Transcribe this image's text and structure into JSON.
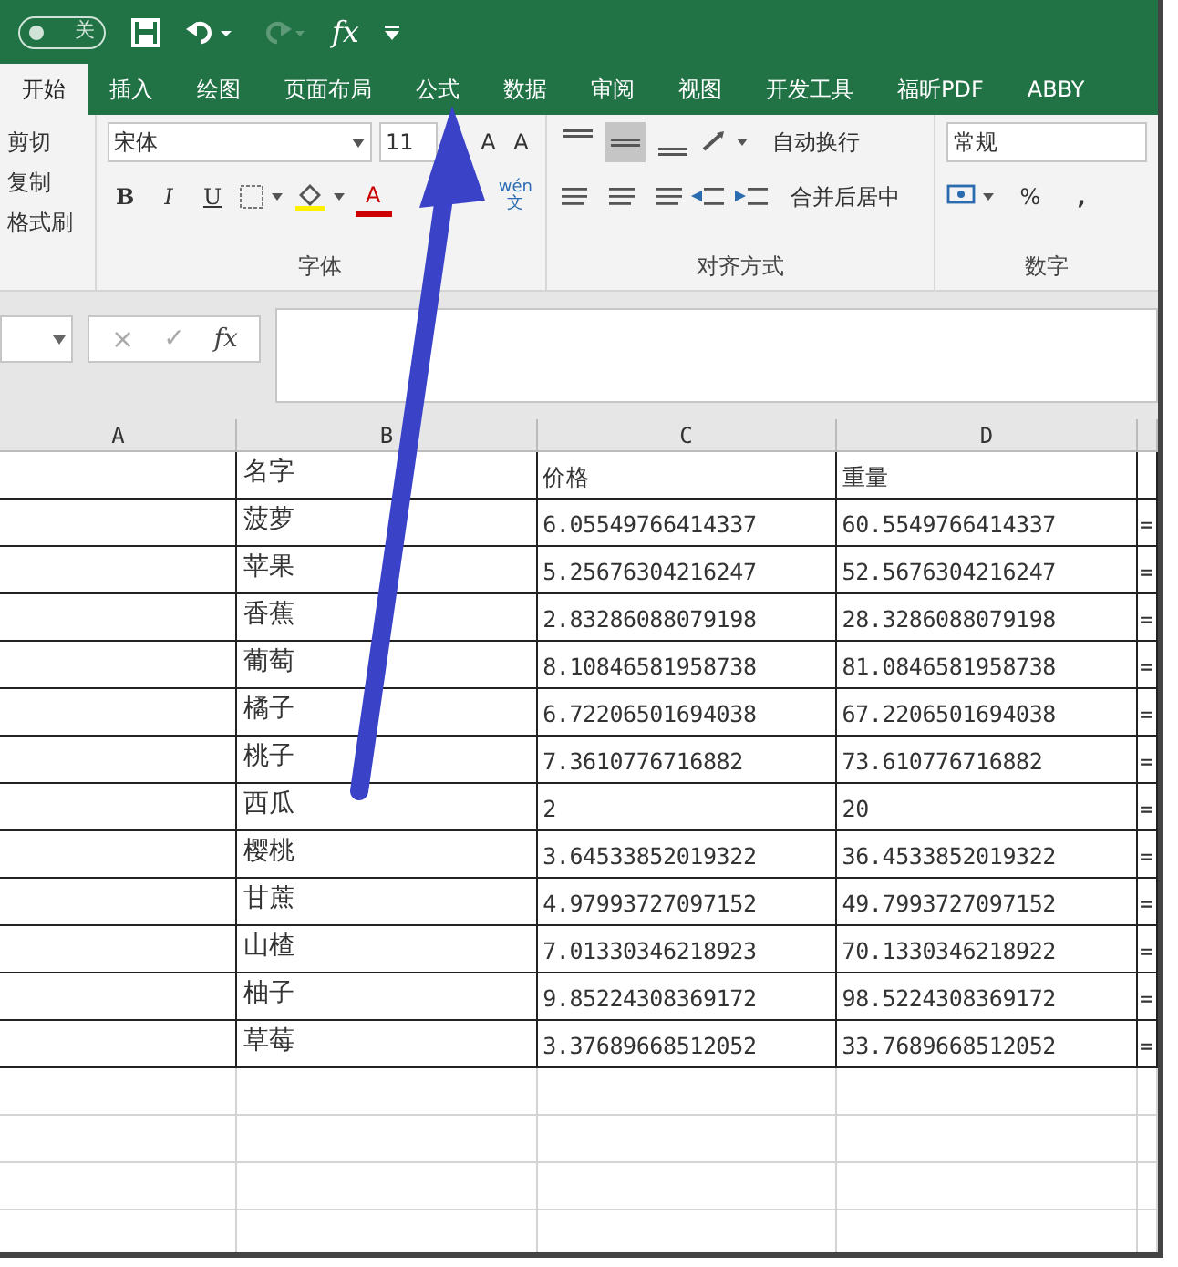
{
  "quick_access": {
    "autosave": {
      "label": "关",
      "on": false
    },
    "redo_disabled": true,
    "formula_symbol": "fx"
  },
  "tabs": [
    {
      "label": "开始",
      "selected": true
    },
    {
      "label": "插入",
      "selected": false
    },
    {
      "label": "绘图",
      "selected": false
    },
    {
      "label": "页面布局",
      "selected": false
    },
    {
      "label": "公式",
      "selected": false
    },
    {
      "label": "数据",
      "selected": false
    },
    {
      "label": "审阅",
      "selected": false
    },
    {
      "label": "视图",
      "selected": false
    },
    {
      "label": "开发工具",
      "selected": false
    },
    {
      "label": "福昕PDF",
      "selected": false
    },
    {
      "label": "ABBY",
      "selected": false
    }
  ],
  "ribbon": {
    "clipboard": {
      "items": [
        "剪切",
        "复制",
        "格式刷"
      ]
    },
    "font": {
      "font_name": "宋体",
      "font_size": "11",
      "grow": "A",
      "shrink": "A",
      "styles": [
        "B",
        "I",
        "U"
      ],
      "font_color": "A",
      "phonetic": {
        "top": "wén",
        "bottom": "文"
      },
      "label": "字体"
    },
    "alignment": {
      "vertical": [
        {
          "selected": false
        },
        {
          "selected": true
        },
        {
          "selected": false
        }
      ],
      "wrap_text": "自动换行",
      "merge": "合并后居中",
      "label": "对齐方式"
    },
    "number": {
      "format": "常规",
      "percent": "%",
      "comma": ",",
      "label": "数字"
    }
  },
  "formula_bar": {
    "cancel": "×",
    "enter": "✓",
    "function": "fx"
  },
  "sheet": {
    "columns": [
      "A",
      "B",
      "C",
      "D"
    ],
    "rows": [
      {
        "cells": [
          "",
          "名字",
          "价格",
          "重量"
        ]
      },
      {
        "cells": [
          "",
          "菠萝",
          "6.05549766414337",
          "60.5549766414337"
        ],
        "column_5": "="
      },
      {
        "cells": [
          "",
          "苹果",
          "5.25676304216247",
          "52.5676304216247"
        ],
        "column_5": "="
      },
      {
        "cells": [
          "",
          "香蕉",
          "2.83286088079198",
          "28.3286088079198"
        ],
        "column_5": "="
      },
      {
        "cells": [
          "",
          "葡萄",
          "8.10846581958738",
          "81.0846581958738"
        ],
        "column_5": "="
      },
      {
        "cells": [
          "",
          "橘子",
          "6.72206501694038",
          "67.2206501694038"
        ],
        "column_5": "="
      },
      {
        "cells": [
          "",
          "桃子",
          "7.3610776716882",
          "73.610776716882"
        ],
        "column_5": "="
      },
      {
        "cells": [
          "",
          "西瓜",
          "2",
          "20"
        ],
        "column_5": "="
      },
      {
        "cells": [
          "",
          "樱桃",
          "3.64533852019322",
          "36.4533852019322"
        ],
        "column_5": "="
      },
      {
        "cells": [
          "",
          "甘蔗",
          "4.97993727097152",
          "49.7993727097152"
        ],
        "column_5": "="
      },
      {
        "cells": [
          "",
          "山楂",
          "7.01330346218923",
          "70.1330346218922"
        ],
        "column_5": "="
      },
      {
        "cells": [
          "",
          "柚子",
          "9.85224308369172",
          "98.5224308369172"
        ],
        "column_5": "="
      },
      {
        "cells": [
          "",
          "草莓",
          "3.37689668512052",
          "33.7689668512052"
        ],
        "column_5": "="
      }
    ]
  }
}
